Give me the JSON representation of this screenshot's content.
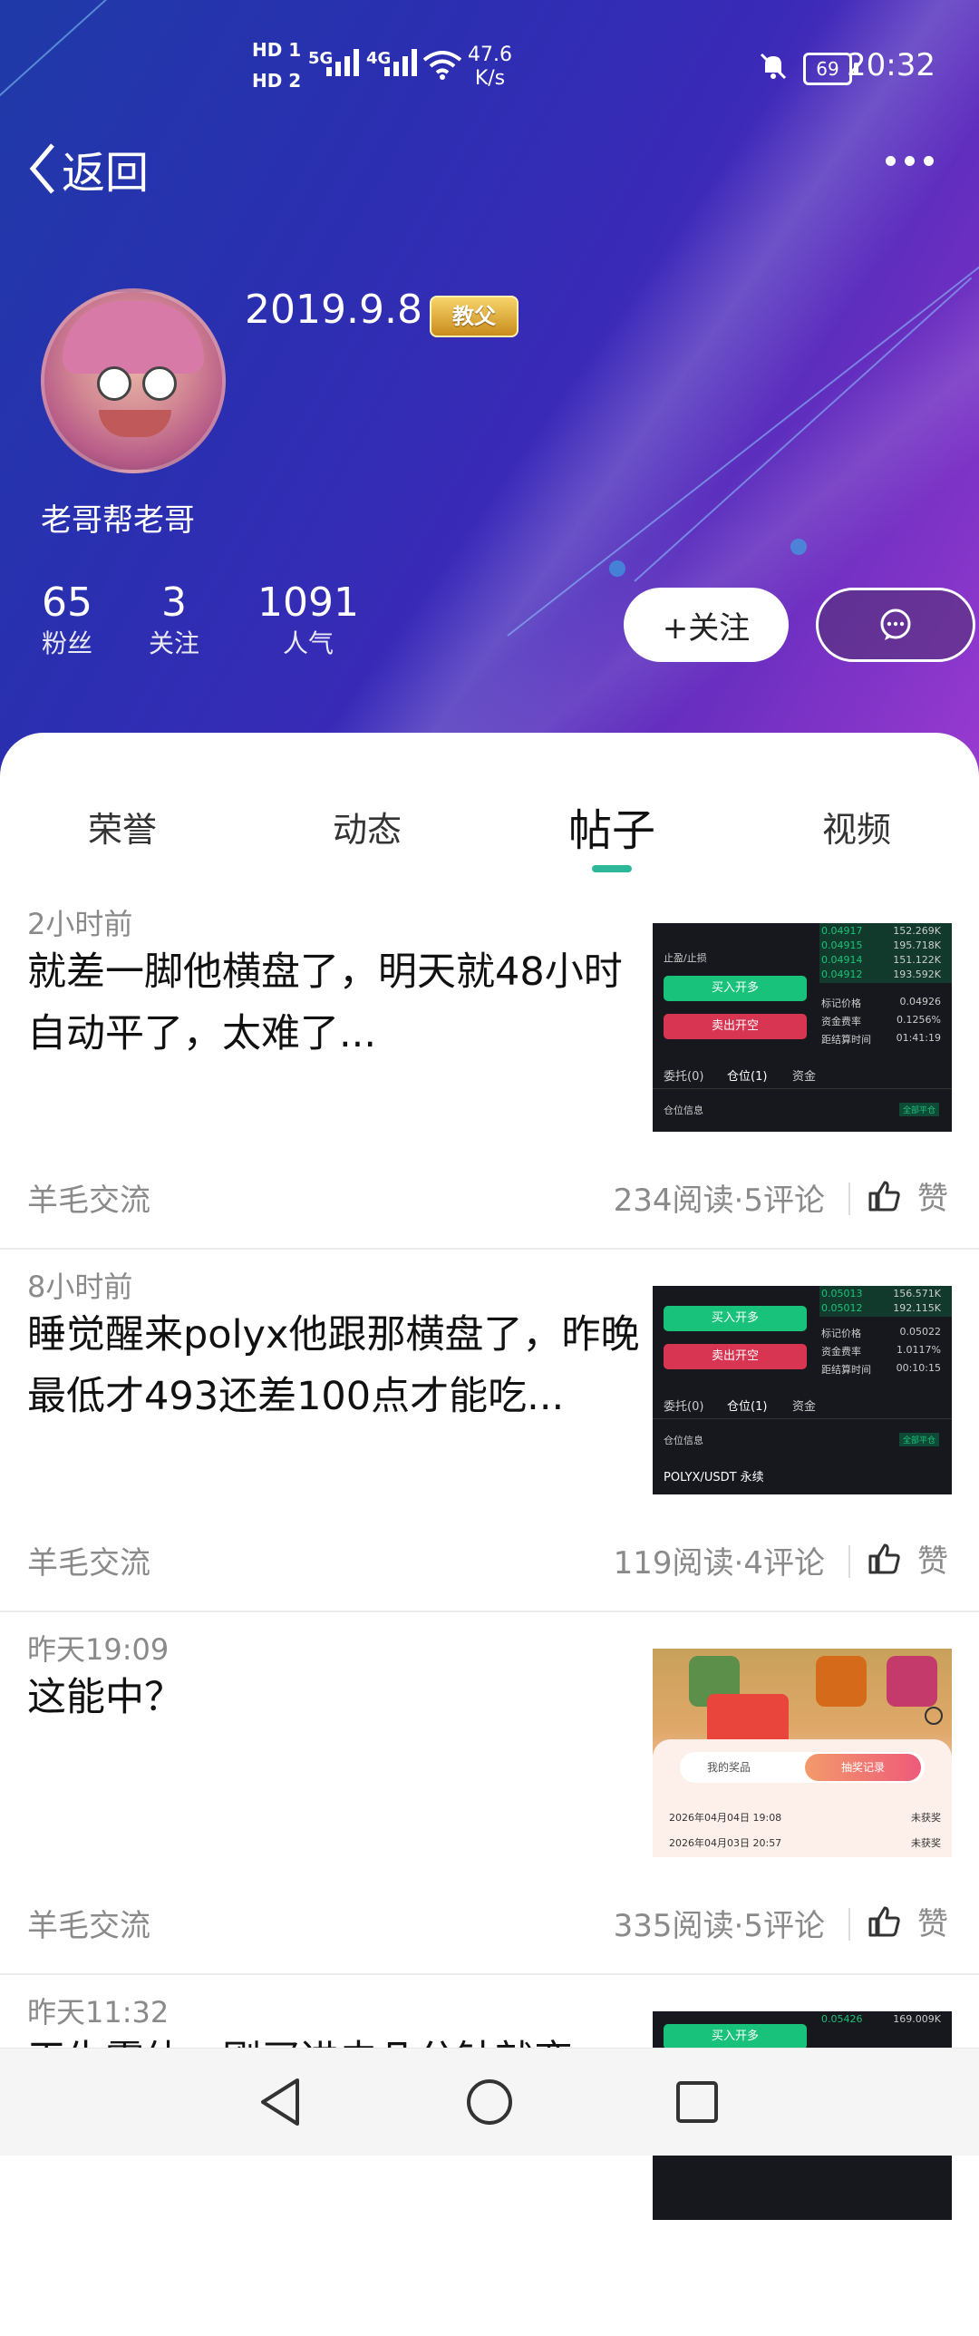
{
  "status_bar": {
    "hd1": "HD 1",
    "hd2": "HD 2",
    "net1": "5G",
    "net2": "4G",
    "speed_value": "47.6",
    "speed_unit": "K/s",
    "battery": "69",
    "time": "20:32"
  },
  "header": {
    "back_label": "返回",
    "username": "2019.9.8",
    "badge": "教父",
    "nickname": "老哥帮老哥",
    "stats": [
      {
        "value": "65",
        "label": "粉丝"
      },
      {
        "value": "3",
        "label": "关注"
      },
      {
        "value": "1091",
        "label": "人气"
      }
    ],
    "follow_label": "+关注"
  },
  "tabs": [
    {
      "label": "荣誉",
      "active": false
    },
    {
      "label": "动态",
      "active": false
    },
    {
      "label": "帖子",
      "active": true
    },
    {
      "label": "视频",
      "active": false
    }
  ],
  "posts": [
    {
      "time": "2小时前",
      "title": "就差一脚他横盘了，明天就48小时自动平了，太难了...",
      "category": "羊毛交流",
      "meta": "234阅读·5评论",
      "like": "赞",
      "thumb": {
        "prices": [
          "0.04917",
          "0.04915",
          "0.04914",
          "0.04912"
        ],
        "vols": [
          "152.269K",
          "195.718K",
          "151.122K",
          "193.592K"
        ],
        "buy": "买入开多",
        "sell": "卖出开空",
        "stop": "止盈/止损",
        "rows": [
          [
            "标记价格",
            "0.04926"
          ],
          [
            "资金费率",
            "0.1256%"
          ],
          [
            "距结算时间",
            "01:41:19"
          ]
        ],
        "tabs": [
          "委托(0)",
          "仓位(1)",
          "资金"
        ],
        "pos_info": "仓位信息",
        "close_all": "全部平仓"
      }
    },
    {
      "time": "8小时前",
      "title": "睡觉醒来polyx他跟那横盘了，昨晚最低才493还差100点才能吃...",
      "category": "羊毛交流",
      "meta": "119阅读·4评论",
      "like": "赞",
      "thumb": {
        "prices": [
          "0.05013",
          "0.05012"
        ],
        "vols": [
          "156.571K",
          "192.115K"
        ],
        "buy": "买入开多",
        "sell": "卖出开空",
        "rows": [
          [
            "标记价格",
            "0.05022"
          ],
          [
            "资金费率",
            "1.0117%"
          ],
          [
            "距结算时间",
            "00:10:15"
          ]
        ],
        "tabs": [
          "委托(0)",
          "仓位(1)",
          "资金"
        ],
        "pos_info": "仓位信息",
        "close_all": "全部平仓",
        "pair": "POLYX/USDT 永续"
      }
    },
    {
      "time": "昨天19:09",
      "title": "这能中？",
      "category": "羊毛交流",
      "meta": "335阅读·5评论",
      "like": "赞",
      "thumb": {
        "tab_left": "我的奖品",
        "tab_right": "抽奖记录",
        "records": [
          [
            "2026年04月04日 19:08",
            "未获奖"
          ],
          [
            "2026年04月03日 20:57",
            "未获奖"
          ]
        ]
      }
    },
    {
      "time": "昨天11:32",
      "title": "天生霉体，刚买进去几分钟就变",
      "thumb": {
        "buy": "买入开多",
        "price": "0.05426",
        "vol": "169.009K"
      }
    }
  ],
  "colors": {
    "accent": "#2db89a",
    "buy_green": "#19c27a",
    "sell_red": "#d83553"
  }
}
